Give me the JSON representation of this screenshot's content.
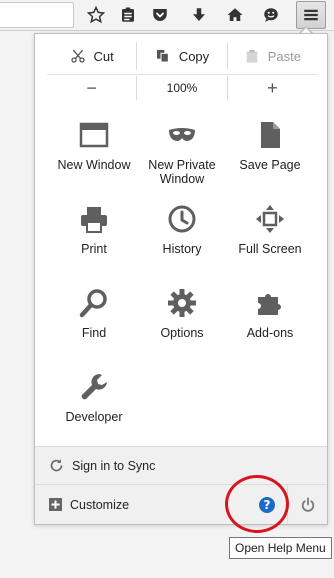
{
  "edit": {
    "cut_label": "Cut",
    "copy_label": "Copy",
    "paste_label": "Paste"
  },
  "zoom": {
    "out_symbol": "−",
    "level": "100%",
    "in_symbol": "+"
  },
  "tiles": [
    {
      "label": "New Window",
      "icon": "new-window-icon"
    },
    {
      "label": "New Private\nWindow",
      "icon": "private-mask-icon"
    },
    {
      "label": "Save Page",
      "icon": "save-page-icon"
    },
    {
      "label": "Print",
      "icon": "printer-icon"
    },
    {
      "label": "History",
      "icon": "clock-icon"
    },
    {
      "label": "Full Screen",
      "icon": "fullscreen-icon"
    },
    {
      "label": "Find",
      "icon": "magnifier-icon"
    },
    {
      "label": "Options",
      "icon": "gear-icon"
    },
    {
      "label": "Add-ons",
      "icon": "puzzle-icon"
    },
    {
      "label": "Developer",
      "icon": "wrench-icon"
    }
  ],
  "footer": {
    "sync_label": "Sign in to Sync",
    "customize_label": "Customize",
    "help_glyph": "?"
  },
  "tooltip": "Open Help Menu",
  "colors": {
    "icon_gray": "#5f5f5f",
    "help_blue": "#1b6ac9",
    "annotation_red": "#d8141e"
  }
}
